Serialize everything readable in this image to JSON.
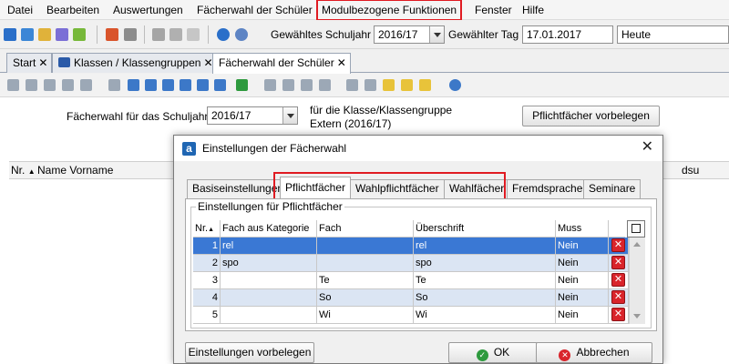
{
  "menu": {
    "items": [
      "Datei",
      "Bearbeiten",
      "Auswertungen",
      "Fächerwahl der Schüler",
      "Modulbezogene Funktionen",
      "Fenster",
      "Hilfe"
    ],
    "highlighted_index": 4
  },
  "toolbar": {
    "schuljahr_label": "Gewähltes Schuljahr",
    "schuljahr_value": "2016/17",
    "tag_label": "Gewählter Tag",
    "tag_value": "17.01.2017",
    "today_value": "Heute"
  },
  "doc_tabs": [
    {
      "label": "Start",
      "active": false
    },
    {
      "label": "Klassen / Klassengruppen",
      "active": false
    },
    {
      "label": "Fächerwahl der Schüler",
      "active": true
    }
  ],
  "page": {
    "schuljahr_label": "Fächerwahl für das Schuljahr",
    "schuljahr_value": "2016/17",
    "klasse_line1": "für die Klasse/Klassengruppe",
    "klasse_line2": "Extern (2016/17)",
    "vorbelegen_button": "Pflichtfächer vorbelegen",
    "grid_columns": {
      "nr": "Nr.",
      "name": "Name Vorname",
      "right": "dsu"
    }
  },
  "dialog": {
    "title": "Einstellungen der Fächerwahl",
    "tabs": [
      "Basiseinstellungen",
      "Pflichtfächer",
      "Wahlpflichtfächer",
      "Wahlfächer",
      "Fremdsprachen",
      "Seminare"
    ],
    "active_tab_index": 1,
    "group_label": "Einstellungen für Pflichtfächer",
    "table": {
      "columns": [
        "Nr.",
        "Fach aus Kategorie",
        "Fach",
        "Überschrift",
        "Muss"
      ],
      "rows": [
        {
          "nr": "1",
          "kategorie": "rel",
          "fach": "",
          "ueberschrift": "rel",
          "muss": "Nein",
          "selected": true
        },
        {
          "nr": "2",
          "kategorie": "spo",
          "fach": "",
          "ueberschrift": "spo",
          "muss": "Nein",
          "selected": false
        },
        {
          "nr": "3",
          "kategorie": "",
          "fach": "Te",
          "ueberschrift": "Te",
          "muss": "Nein",
          "selected": false
        },
        {
          "nr": "4",
          "kategorie": "",
          "fach": "So",
          "ueberschrift": "So",
          "muss": "Nein",
          "selected": false
        },
        {
          "nr": "5",
          "kategorie": "",
          "fach": "Wi",
          "ueberschrift": "Wi",
          "muss": "Nein",
          "selected": false
        }
      ]
    },
    "buttons": {
      "vorbelegen": "Einstellungen vorbelegen",
      "ok": "OK",
      "cancel": "Abbrechen"
    }
  },
  "colors": {
    "highlight_red": "#e01b22",
    "row_selected": "#3a78d4",
    "row_even": "#dbe5f3",
    "row_odd": "#ffffff",
    "delete_icon": "#d9242b"
  }
}
